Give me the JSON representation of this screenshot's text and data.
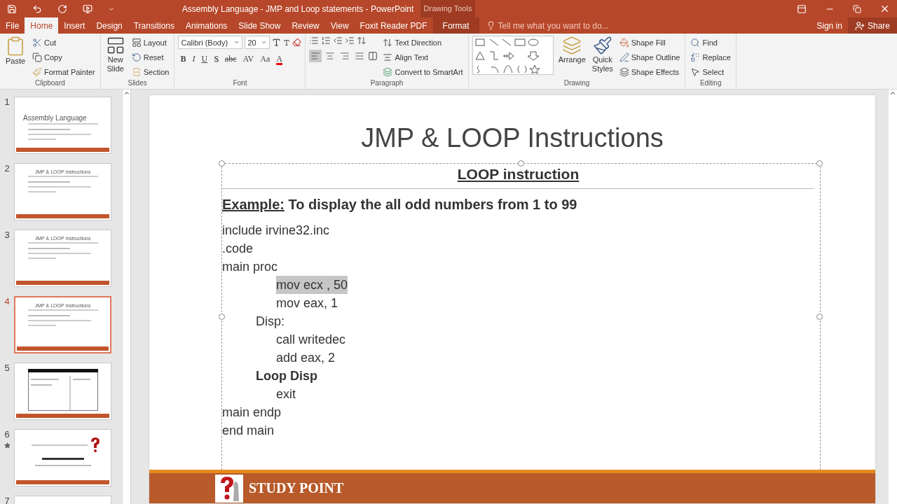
{
  "title_bar": {
    "title": "Assembly Language - JMP and Loop statements - PowerPoint",
    "context_label": "Drawing Tools"
  },
  "tabs": [
    {
      "label": "File",
      "selected": false,
      "kind": "normal"
    },
    {
      "label": "Home",
      "selected": true,
      "kind": "normal"
    },
    {
      "label": "Insert",
      "selected": false,
      "kind": "normal"
    },
    {
      "label": "Design",
      "selected": false,
      "kind": "normal"
    },
    {
      "label": "Transitions",
      "selected": false,
      "kind": "normal"
    },
    {
      "label": "Animations",
      "selected": false,
      "kind": "normal"
    },
    {
      "label": "Slide Show",
      "selected": false,
      "kind": "normal"
    },
    {
      "label": "Review",
      "selected": false,
      "kind": "normal"
    },
    {
      "label": "View",
      "selected": false,
      "kind": "normal"
    },
    {
      "label": "Foxit Reader PDF",
      "selected": false,
      "kind": "normal"
    },
    {
      "label": "Format",
      "selected": false,
      "kind": "context"
    }
  ],
  "tell_me": {
    "placeholder": "Tell me what you want to do..."
  },
  "sign_in": "Sign in",
  "share": "Share",
  "ribbon": {
    "clipboard": {
      "paste": "Paste",
      "cut": "Cut",
      "copy": "Copy",
      "format_painter": "Format Painter",
      "label": "Clipboard"
    },
    "slides": {
      "new_slide": [
        "New",
        "Slide"
      ],
      "layout": "Layout",
      "reset": "Reset",
      "section": "Section",
      "label": "Slides"
    },
    "font": {
      "font_name": "Calibri (Body)",
      "font_size": "20",
      "format_buttons": [
        {
          "text": "B",
          "kind": "bold"
        },
        {
          "text": "I",
          "kind": "italic"
        },
        {
          "text": "U",
          "kind": "underline"
        },
        {
          "text": "S",
          "kind": "shadow"
        },
        {
          "text": "abc",
          "kind": "strike"
        },
        {
          "text": "AV",
          "kind": "spacing"
        },
        {
          "text": "Aa",
          "kind": "case"
        },
        {
          "text": "A",
          "kind": "color"
        }
      ],
      "label": "Font"
    },
    "paragraph": {
      "alignments": [
        {
          "kind": "left",
          "selected": true
        },
        {
          "kind": "center",
          "selected": false
        },
        {
          "kind": "right",
          "selected": false
        },
        {
          "kind": "justify",
          "selected": false
        }
      ],
      "text_direction": "Text Direction",
      "align_text": "Align Text",
      "convert": "Convert to SmartArt",
      "label": "Paragraph"
    },
    "drawing": {
      "arrange": "Arrange",
      "quick_styles": [
        "Quick",
        "Styles"
      ],
      "shape_fill": "Shape Fill",
      "shape_outline": "Shape Outline",
      "shape_effects": "Shape Effects",
      "label": "Drawing"
    },
    "editing": {
      "find": "Find",
      "replace": "Replace",
      "select": "Select",
      "label": "Editing"
    }
  },
  "thumbnails": [
    {
      "number": "1",
      "title": "Assembly Language",
      "kind": "cover",
      "selected": false,
      "animated": false
    },
    {
      "number": "2",
      "title": "JMP & LOOP Instructions",
      "kind": "content",
      "selected": false,
      "animated": false
    },
    {
      "number": "3",
      "title": "JMP & LOOP Instructions",
      "kind": "content",
      "selected": false,
      "animated": false
    },
    {
      "number": "4",
      "title": "JMP & LOOP Instructions",
      "kind": "content",
      "selected": true,
      "animated": false
    },
    {
      "number": "5",
      "kind": "table",
      "selected": false,
      "animated": false
    },
    {
      "number": "6",
      "kind": "question",
      "selected": false,
      "animated": true
    },
    {
      "number": "7",
      "kind": "blank",
      "selected": false,
      "animated": false
    }
  ],
  "slide": {
    "title": "JMP & LOOP Instructions",
    "heading": "LOOP instruction",
    "example_label": "Example:",
    "example_text": " To display the all odd numbers from 1 to 99",
    "code": [
      {
        "text": "include irvine32.inc",
        "kind": "top",
        "bold": false,
        "highlighted": false
      },
      {
        "text": ".code",
        "kind": "top",
        "bold": false,
        "highlighted": false
      },
      {
        "text": "main proc",
        "kind": "top",
        "bold": false,
        "highlighted": false
      },
      {
        "text": "mov ecx , 50",
        "kind": "instruction",
        "bold": false,
        "highlighted": true
      },
      {
        "text": "mov eax, 1",
        "kind": "instruction",
        "bold": false,
        "highlighted": false
      },
      {
        "text": "Disp:",
        "kind": "label",
        "bold": false,
        "highlighted": false
      },
      {
        "text": "call writedec",
        "kind": "instruction",
        "bold": false,
        "highlighted": false
      },
      {
        "text": "add eax, 2",
        "kind": "instruction",
        "bold": false,
        "highlighted": false
      },
      {
        "text": "Loop Disp",
        "kind": "label",
        "bold": true,
        "highlighted": false
      },
      {
        "text": "exit",
        "kind": "instruction",
        "bold": false,
        "highlighted": false
      },
      {
        "text": "main endp",
        "kind": "top",
        "bold": false,
        "highlighted": false
      },
      {
        "text": "end main",
        "kind": "top",
        "bold": false,
        "highlighted": false
      }
    ],
    "footer": "STUDY POINT"
  }
}
